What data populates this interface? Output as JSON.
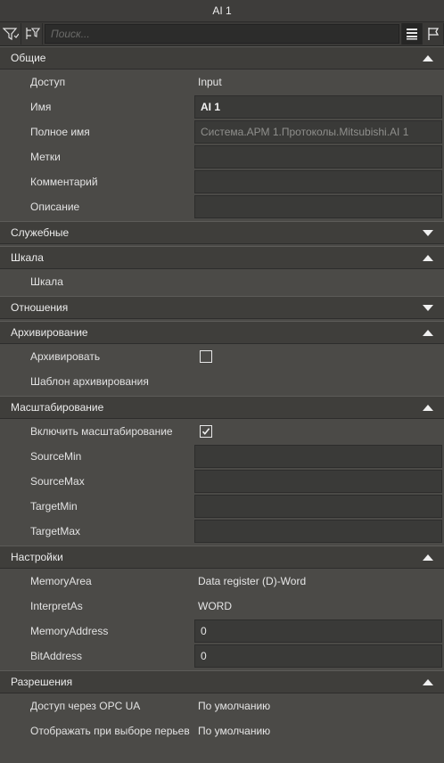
{
  "window": {
    "title": "AI 1"
  },
  "toolbar": {
    "search_placeholder": "Поиск..."
  },
  "sections": {
    "general": {
      "title": "Общие",
      "rows": [
        {
          "name": "Доступ",
          "value": "Input"
        },
        {
          "name": "Имя",
          "value": "AI 1"
        },
        {
          "name": "Полное имя",
          "value": "Система.АРМ 1.Протоколы.Mitsubishi.AI 1"
        },
        {
          "name": "Метки",
          "value": ""
        },
        {
          "name": "Комментарий",
          "value": ""
        },
        {
          "name": "Описание",
          "value": ""
        }
      ]
    },
    "service": {
      "title": "Служебные"
    },
    "scale": {
      "title": "Шкала",
      "rows": [
        {
          "name": "Шкала"
        }
      ]
    },
    "relations": {
      "title": "Отношения"
    },
    "archiving": {
      "title": "Архивирование",
      "rows": [
        {
          "name": "Архивировать",
          "checked": false
        },
        {
          "name": "Шаблон архивирования"
        }
      ]
    },
    "scaling": {
      "title": "Масштабирование",
      "rows": [
        {
          "name": "Включить масштабирование",
          "checked": true
        },
        {
          "name": "SourceMin",
          "value": ""
        },
        {
          "name": "SourceMax",
          "value": ""
        },
        {
          "name": "TargetMin",
          "value": ""
        },
        {
          "name": "TargetMax",
          "value": ""
        }
      ]
    },
    "settings": {
      "title": "Настройки",
      "rows": [
        {
          "name": "MemoryArea",
          "value": "Data register (D)-Word"
        },
        {
          "name": "InterpretAs",
          "value": "WORD"
        },
        {
          "name": "MemoryAddress",
          "value": "0"
        },
        {
          "name": "BitAddress",
          "value": "0"
        }
      ]
    },
    "permissions": {
      "title": "Разрешения",
      "rows": [
        {
          "name": "Доступ через OPC UA",
          "value": "По умолчанию"
        },
        {
          "name": "Отображать при выборе перьев",
          "value": "По умолчанию"
        }
      ]
    }
  }
}
